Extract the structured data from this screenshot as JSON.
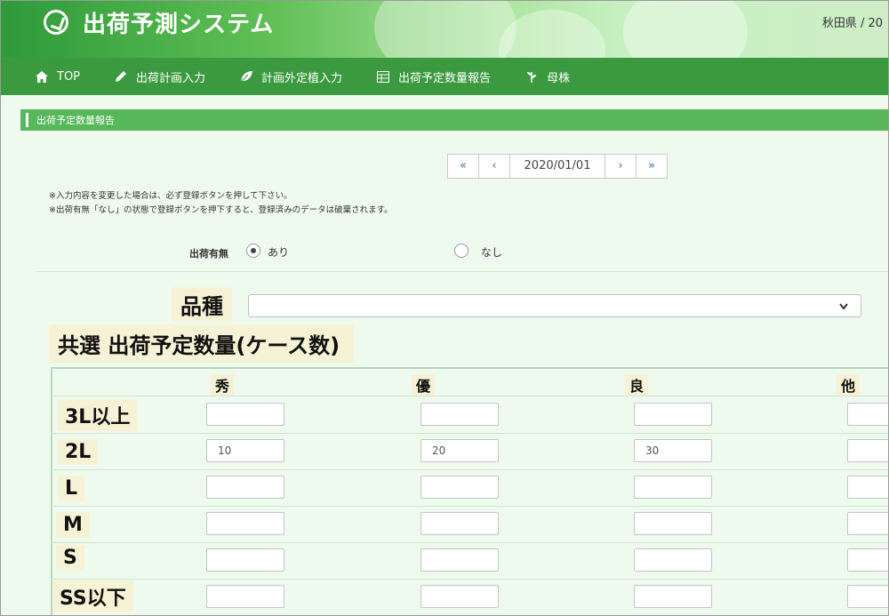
{
  "header": {
    "app_title": "出荷予測システム",
    "user_info": "秋田県 / 20"
  },
  "nav": {
    "items": [
      {
        "label": "TOP",
        "icon": "home-icon"
      },
      {
        "label": "出荷計画入力",
        "icon": "pencil-icon"
      },
      {
        "label": "計画外定植入力",
        "icon": "leaf-icon"
      },
      {
        "label": "出荷予定数量報告",
        "icon": "table-icon"
      },
      {
        "label": "母株",
        "icon": "sprout-icon"
      }
    ]
  },
  "section": {
    "title": "出荷予定数量報告"
  },
  "pager": {
    "first": "«",
    "prev": "‹",
    "date": "2020/01/01",
    "next": "›",
    "last": "»"
  },
  "notes": [
    "※入力内容を変更した場合は、必ず登録ボタンを押して下さい。",
    "※出荷有無「なし」の状態で登録ボタンを押下すると、登録済みのデータは破棄されます。"
  ],
  "shipment": {
    "label": "出荷有無",
    "options": [
      {
        "label": "あり",
        "selected": true
      },
      {
        "label": "なし",
        "selected": false
      }
    ]
  },
  "variety": {
    "label": "品種",
    "value": ""
  },
  "quantity_title": "共選  出荷予定数量(ケース数)",
  "grid": {
    "columns": [
      "秀",
      "優",
      "良",
      "他"
    ],
    "rows": [
      {
        "label": "3L以上",
        "values": [
          "",
          "",
          "",
          ""
        ]
      },
      {
        "label": "2L",
        "values": [
          "10",
          "20",
          "30",
          ""
        ]
      },
      {
        "label": "L",
        "values": [
          "",
          "",
          "",
          ""
        ]
      },
      {
        "label": "M",
        "values": [
          "",
          "",
          "",
          ""
        ]
      },
      {
        "label": "S",
        "values": [
          "",
          "",
          "",
          ""
        ]
      },
      {
        "label": "SS以下",
        "values": [
          "",
          "",
          "",
          ""
        ]
      }
    ]
  },
  "colors": {
    "nav": "#3b9a3f",
    "section_bar": "#56b85a",
    "highlight": "#f6f2d5",
    "background": "#effaef"
  }
}
